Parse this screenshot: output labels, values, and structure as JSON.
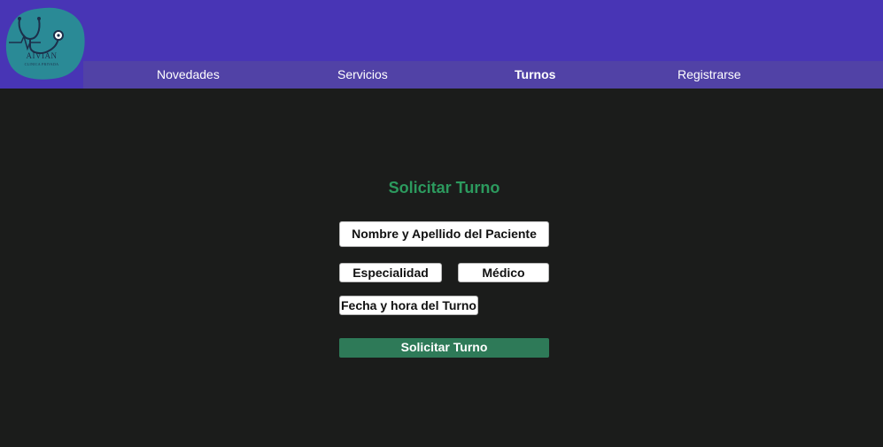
{
  "brand": {
    "name": "AIVIAN",
    "subtitle": "CLINICA PRIVADA"
  },
  "nav": {
    "items": [
      {
        "label": "Novedades"
      },
      {
        "label": "Servicios"
      },
      {
        "label": "Turnos",
        "active": true
      },
      {
        "label": "Registrarse"
      }
    ]
  },
  "form": {
    "title": "Solicitar Turno",
    "patient_name": "Nombre y Apellido del Paciente",
    "specialty": "Especialidad",
    "doctor": "Médico",
    "datetime": "Fecha y hora del Turno",
    "submit_label": "Solicitar Turno"
  },
  "colors": {
    "header": "#4835b5",
    "nav": "#5142a6",
    "background": "#1b1c1b",
    "title": "#2c9a5e",
    "button": "#2e7a58",
    "logo": "#2a8a96"
  }
}
